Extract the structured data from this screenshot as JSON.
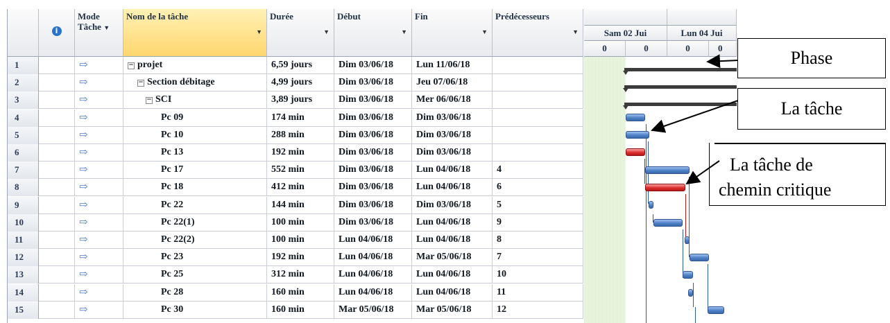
{
  "columns": {
    "mode_line1": "Mode",
    "mode_line2": "Tâche",
    "task_name": "Nom de la tâche",
    "duration": "Durée",
    "start": "Début",
    "end": "Fin",
    "predecessors": "Prédécesseurs",
    "info_icon": "info-icon"
  },
  "timescale": {
    "day1": "Sam 02 Jui",
    "day2": "Lun 04 Jui",
    "sub": [
      "0",
      "0",
      "0",
      "0"
    ]
  },
  "rows": [
    {
      "n": "1",
      "name": "projet",
      "indent": 0,
      "toggle": true,
      "duration": "6,59 jours",
      "start": "Dim 03/06/18",
      "end": "Lun 11/06/18",
      "pred": ""
    },
    {
      "n": "2",
      "name": "Section débitage",
      "indent": 1,
      "toggle": true,
      "duration": "4,99 jours",
      "start": "Dim 03/06/18",
      "end": "Jeu 07/06/18",
      "pred": ""
    },
    {
      "n": "3",
      "name": "SCI",
      "indent": 2,
      "toggle": true,
      "duration": "3,89 jours",
      "start": "Dim 03/06/18",
      "end": "Mer 06/06/18",
      "pred": ""
    },
    {
      "n": "4",
      "name": "Pc 09",
      "indent": 3,
      "toggle": false,
      "duration": "174 min",
      "start": "Dim 03/06/18",
      "end": "Dim 03/06/18",
      "pred": ""
    },
    {
      "n": "5",
      "name": "Pc 10",
      "indent": 3,
      "toggle": false,
      "duration": "288 min",
      "start": "Dim 03/06/18",
      "end": "Dim 03/06/18",
      "pred": ""
    },
    {
      "n": "6",
      "name": "Pc 13",
      "indent": 3,
      "toggle": false,
      "duration": "192 min",
      "start": "Dim 03/06/18",
      "end": "Dim 03/06/18",
      "pred": ""
    },
    {
      "n": "7",
      "name": "Pc 17",
      "indent": 3,
      "toggle": false,
      "duration": "552 min",
      "start": "Dim 03/06/18",
      "end": "Lun 04/06/18",
      "pred": "4"
    },
    {
      "n": "8",
      "name": "Pc 18",
      "indent": 3,
      "toggle": false,
      "duration": "412 min",
      "start": "Dim 03/06/18",
      "end": "Lun 04/06/18",
      "pred": "6"
    },
    {
      "n": "9",
      "name": "Pc 22",
      "indent": 3,
      "toggle": false,
      "duration": "144 min",
      "start": "Dim 03/06/18",
      "end": "Dim 03/06/18",
      "pred": "5"
    },
    {
      "n": "10",
      "name": "Pc 22(1)",
      "indent": 3,
      "toggle": false,
      "duration": "100 min",
      "start": "Dim 03/06/18",
      "end": "Lun 04/06/18",
      "pred": "9"
    },
    {
      "n": "11",
      "name": "Pc 22(2)",
      "indent": 3,
      "toggle": false,
      "duration": "100 min",
      "start": "Lun 04/06/18",
      "end": "Lun 04/06/18",
      "pred": "8"
    },
    {
      "n": "12",
      "name": "Pc 23",
      "indent": 3,
      "toggle": false,
      "duration": "192 min",
      "start": "Lun 04/06/18",
      "end": "Mar 05/06/18",
      "pred": "7"
    },
    {
      "n": "13",
      "name": "Pc 25",
      "indent": 3,
      "toggle": false,
      "duration": "312 min",
      "start": "Lun 04/06/18",
      "end": "Lun 04/06/18",
      "pred": "10"
    },
    {
      "n": "14",
      "name": "Pc 28",
      "indent": 3,
      "toggle": false,
      "duration": "160 min",
      "start": "Lun 04/06/18",
      "end": "Lun 04/06/18",
      "pred": "11"
    },
    {
      "n": "15",
      "name": "Pc 30",
      "indent": 3,
      "toggle": false,
      "duration": "160 min",
      "start": "Mar 05/06/18",
      "end": "Mar 05/06/18",
      "pred": "12"
    }
  ],
  "annotations": {
    "phase": "Phase",
    "task": "La tâche",
    "critical_line1": "La tâche de",
    "critical_line2": "chemin critique"
  },
  "colors": {
    "task_bar": "#4f81c7",
    "critical_bar": "#dc2f2f",
    "summary_bar": "#3b3b3b",
    "selected_header": "#ffd66e"
  }
}
